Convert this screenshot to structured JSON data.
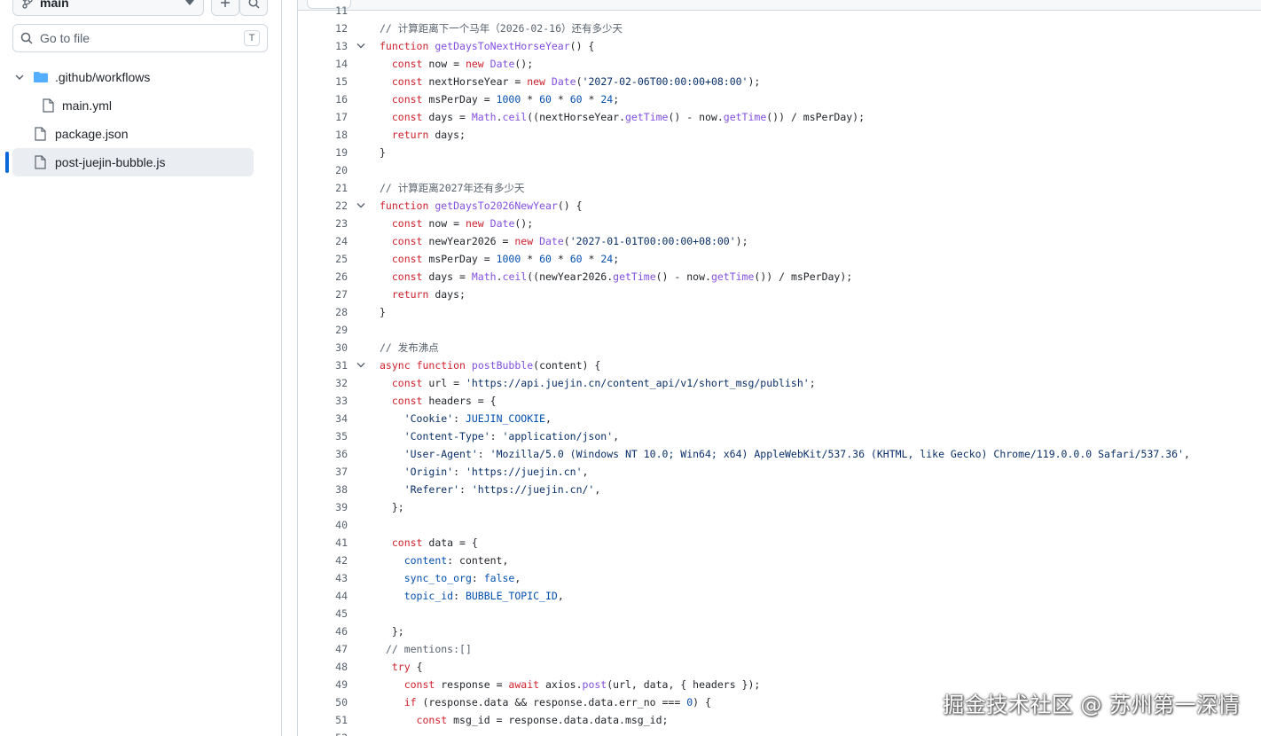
{
  "sidebar": {
    "branch": {
      "name": "main"
    },
    "goto_file": {
      "placeholder": "Go to file",
      "shortcut": "T"
    },
    "tree": [
      {
        "label": ".github/workflows",
        "type": "folder",
        "expanded": true
      },
      {
        "label": "main.yml",
        "type": "file"
      },
      {
        "label": "package.json",
        "type": "file"
      },
      {
        "label": "post-juejin-bubble.js",
        "type": "file",
        "selected": true
      }
    ]
  },
  "code": {
    "lines": [
      {
        "n": "11",
        "t": "",
        "fold": false
      },
      {
        "n": "12",
        "t": "// 计算距离下一个马年（2026-02-16）还有多少天",
        "fold": false
      },
      {
        "n": "13",
        "t": "function getDaysToNextHorseYear() {",
        "fold": true
      },
      {
        "n": "14",
        "t": "  const now = new Date();",
        "fold": false
      },
      {
        "n": "15",
        "t": "  const nextHorseYear = new Date('2027-02-06T00:00:00+08:00');",
        "fold": false
      },
      {
        "n": "16",
        "t": "  const msPerDay = 1000 * 60 * 60 * 24;",
        "fold": false
      },
      {
        "n": "17",
        "t": "  const days = Math.ceil((nextHorseYear.getTime() - now.getTime()) / msPerDay);",
        "fold": false
      },
      {
        "n": "18",
        "t": "  return days;",
        "fold": false
      },
      {
        "n": "19",
        "t": "}",
        "fold": false
      },
      {
        "n": "20",
        "t": "",
        "fold": false
      },
      {
        "n": "21",
        "t": "// 计算距离2027年还有多少天",
        "fold": false
      },
      {
        "n": "22",
        "t": "function getDaysTo2026NewYear() {",
        "fold": true
      },
      {
        "n": "23",
        "t": "  const now = new Date();",
        "fold": false
      },
      {
        "n": "24",
        "t": "  const newYear2026 = new Date('2027-01-01T00:00:00+08:00');",
        "fold": false
      },
      {
        "n": "25",
        "t": "  const msPerDay = 1000 * 60 * 60 * 24;",
        "fold": false
      },
      {
        "n": "26",
        "t": "  const days = Math.ceil((newYear2026.getTime() - now.getTime()) / msPerDay);",
        "fold": false
      },
      {
        "n": "27",
        "t": "  return days;",
        "fold": false
      },
      {
        "n": "28",
        "t": "}",
        "fold": false
      },
      {
        "n": "29",
        "t": "",
        "fold": false
      },
      {
        "n": "30",
        "t": "// 发布沸点",
        "fold": false
      },
      {
        "n": "31",
        "t": "async function postBubble(content) {",
        "fold": true
      },
      {
        "n": "32",
        "t": "  const url = 'https://api.juejin.cn/content_api/v1/short_msg/publish';",
        "fold": false
      },
      {
        "n": "33",
        "t": "  const headers = {",
        "fold": false
      },
      {
        "n": "34",
        "t": "    'Cookie': JUEJIN_COOKIE,",
        "fold": false
      },
      {
        "n": "35",
        "t": "    'Content-Type': 'application/json',",
        "fold": false
      },
      {
        "n": "36",
        "t": "    'User-Agent': 'Mozilla/5.0 (Windows NT 10.0; Win64; x64) AppleWebKit/537.36 (KHTML, like Gecko) Chrome/119.0.0.0 Safari/537.36',",
        "fold": false
      },
      {
        "n": "37",
        "t": "    'Origin': 'https://juejin.cn',",
        "fold": false
      },
      {
        "n": "38",
        "t": "    'Referer': 'https://juejin.cn/',",
        "fold": false
      },
      {
        "n": "39",
        "t": "  };",
        "fold": false
      },
      {
        "n": "40",
        "t": "",
        "fold": false
      },
      {
        "n": "41",
        "t": "  const data = {",
        "fold": false
      },
      {
        "n": "42",
        "t": "    content: content,",
        "fold": false
      },
      {
        "n": "43",
        "t": "    sync_to_org: false,",
        "fold": false
      },
      {
        "n": "44",
        "t": "    topic_id: BUBBLE_TOPIC_ID,",
        "fold": false
      },
      {
        "n": "45",
        "t": "",
        "fold": false
      },
      {
        "n": "46",
        "t": "  };",
        "fold": false
      },
      {
        "n": "47",
        "t": " // mentions:[]",
        "fold": false
      },
      {
        "n": "48",
        "t": "  try {",
        "fold": false
      },
      {
        "n": "49",
        "t": "    const response = await axios.post(url, data, { headers });",
        "fold": false
      },
      {
        "n": "50",
        "t": "    if (response.data && response.data.err_no === 0) {",
        "fold": false
      },
      {
        "n": "51",
        "t": "      const msg_id = response.data.data.msg_id;",
        "fold": false
      },
      {
        "n": "52",
        "t": "",
        "fold": false
      }
    ]
  },
  "watermark": "掘金技术社区 @ 苏州第一深情"
}
